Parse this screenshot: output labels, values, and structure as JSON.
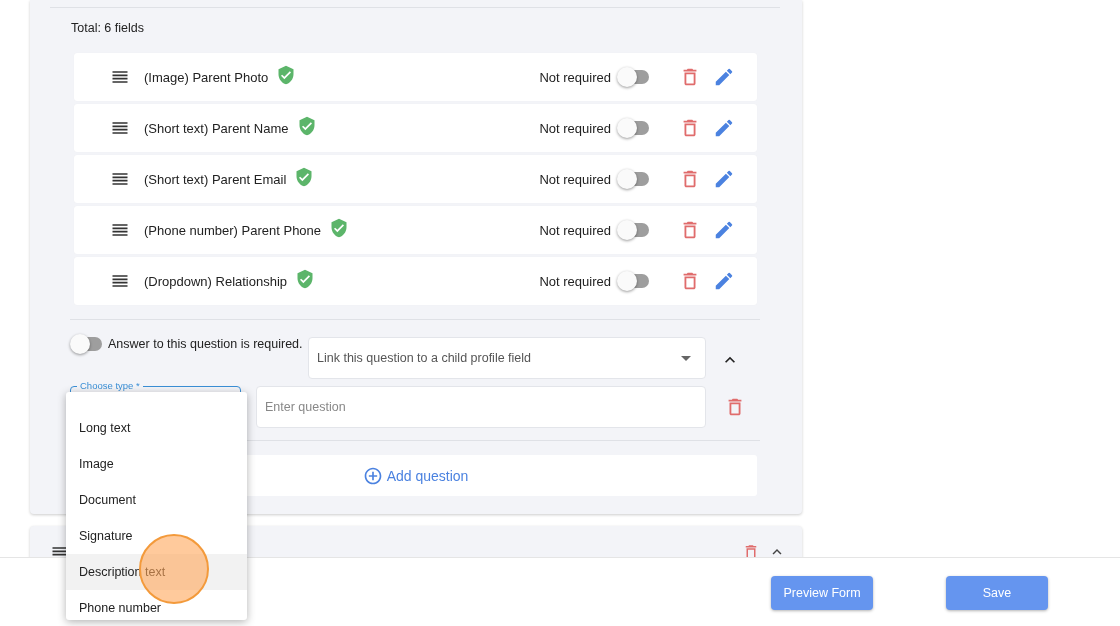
{
  "total": "Total: 6 fields",
  "fields": [
    {
      "label": "(Image) Parent Photo",
      "verified": true,
      "status": "Not required",
      "required": false
    },
    {
      "label": "(Short text) Parent Name",
      "verified": true,
      "status": "Not required",
      "required": false
    },
    {
      "label": "(Short text) Parent Email",
      "verified": true,
      "status": "Not required",
      "required": false
    },
    {
      "label": "(Phone number) Parent Phone",
      "verified": true,
      "status": "Not required",
      "required": false
    },
    {
      "label": "(Dropdown) Relationship",
      "verified": true,
      "status": "Not required",
      "required": false
    }
  ],
  "new_question": {
    "required_toggle": {
      "on": false,
      "label": "Answer to this question is required."
    },
    "link_select": {
      "placeholder": "Link this question to a child profile field"
    },
    "expanded": true,
    "type_field": {
      "label": "Choose type *"
    },
    "question_field": {
      "placeholder": "Enter question"
    }
  },
  "add_question": "Add question",
  "type_menu": {
    "items": [
      {
        "label": "Long text",
        "highlighted": false
      },
      {
        "label": "Image",
        "highlighted": false
      },
      {
        "label": "Document",
        "highlighted": false
      },
      {
        "label": "Signature",
        "highlighted": false
      },
      {
        "label": "Description text",
        "highlighted": true
      },
      {
        "label": "Phone number",
        "highlighted": false
      }
    ]
  },
  "footer": {
    "buttons": [
      "Preview Form",
      "Save"
    ]
  }
}
